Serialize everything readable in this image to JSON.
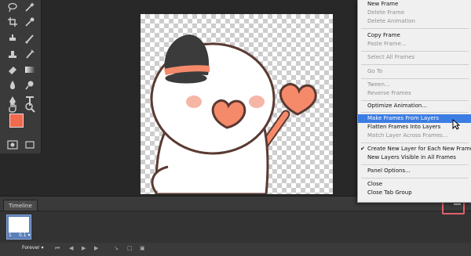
{
  "timeline": {
    "tab_label": "Timeline",
    "frame_number": "1",
    "frame_delay": "0.1 ▾",
    "loop": "Forever ▾"
  },
  "menu": {
    "items": [
      {
        "label": "New Frame",
        "disabled": false
      },
      {
        "label": "Delete Frame",
        "disabled": true
      },
      {
        "label": "Delete Animation",
        "disabled": true
      },
      {
        "label": "Copy Frame",
        "disabled": false
      },
      {
        "label": "Paste Frame...",
        "disabled": true
      },
      {
        "label": "Select All Frames",
        "disabled": true
      },
      {
        "label": "Go To",
        "disabled": true
      },
      {
        "label": "Tween...",
        "disabled": true
      },
      {
        "label": "Reverse Frames",
        "disabled": true
      },
      {
        "label": "Optimize Animation...",
        "disabled": false
      },
      {
        "label": "Make Frames From Layers",
        "disabled": false,
        "highlighted": true
      },
      {
        "label": "Flatten Frames Into Layers",
        "disabled": false
      },
      {
        "label": "Match Layer Across Frames...",
        "disabled": true
      },
      {
        "label": "Create New Layer for Each New Frame",
        "disabled": false,
        "checked": true
      },
      {
        "label": "New Layers Visible in All Frames",
        "disabled": false
      },
      {
        "label": "Panel Options...",
        "disabled": false
      },
      {
        "label": "Close",
        "disabled": false
      },
      {
        "label": "Close Tab Group",
        "disabled": false
      }
    ]
  },
  "colors": {
    "foreground": "#f06a4e",
    "background": "#ffffff",
    "menu_highlight": "#3b7de3",
    "callout_border": "#e0606a"
  },
  "icons": [
    "lasso-icon",
    "magic-wand-icon",
    "crop-icon",
    "eyedropper-icon",
    "healing-brush-icon",
    "brush-icon",
    "clone-stamp-icon",
    "history-brush-icon",
    "eraser-icon",
    "gradient-icon",
    "blur-icon",
    "dodge-icon",
    "pen-icon",
    "type-icon",
    "path-select-icon",
    "shape-icon",
    "hand-icon",
    "zoom-icon",
    "panel-menu-icon",
    "cursor-icon"
  ]
}
